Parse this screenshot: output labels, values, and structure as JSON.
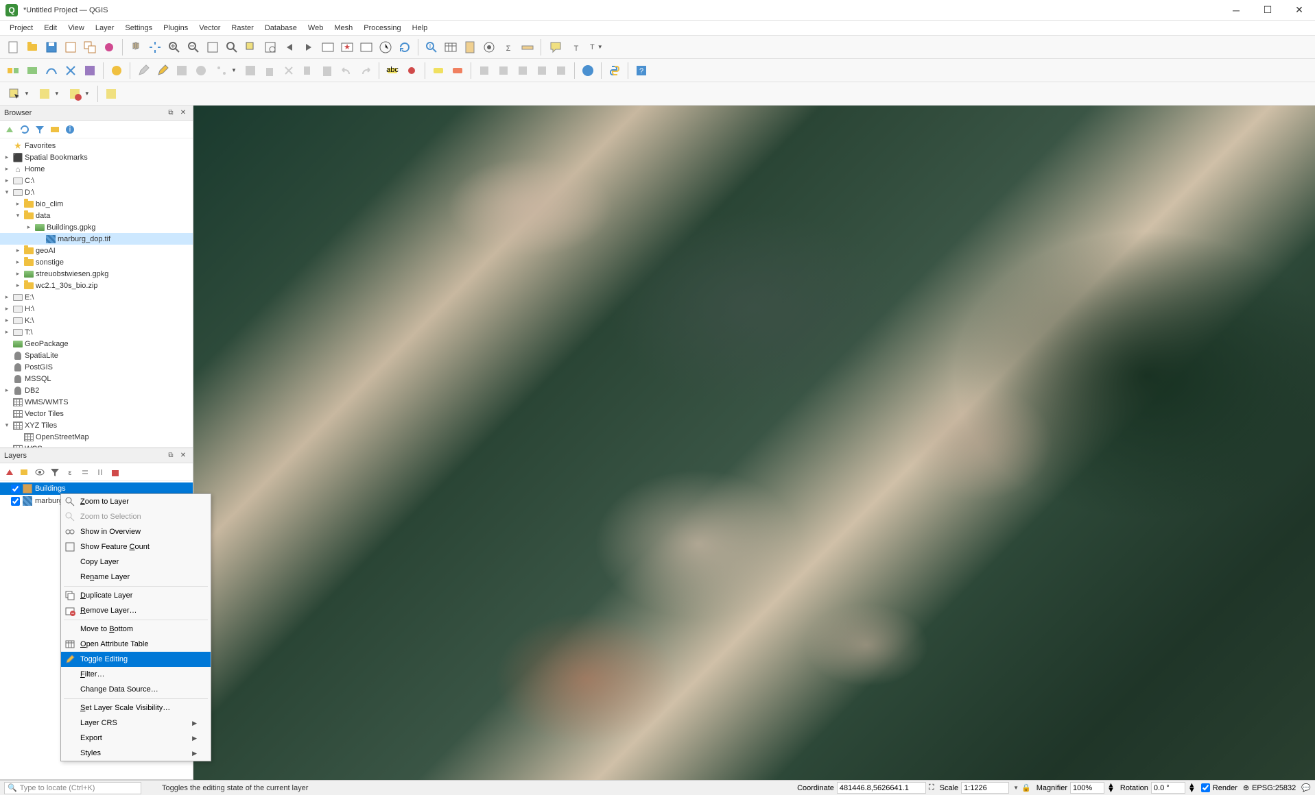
{
  "window": {
    "title": "*Untitled Project — QGIS"
  },
  "menubar": [
    "Project",
    "Edit",
    "View",
    "Layer",
    "Settings",
    "Plugins",
    "Vector",
    "Raster",
    "Database",
    "Web",
    "Mesh",
    "Processing",
    "Help"
  ],
  "browser": {
    "title": "Browser",
    "items": [
      {
        "label": "Favorites",
        "icon": "star",
        "indent": 0,
        "exp": ""
      },
      {
        "label": "Spatial Bookmarks",
        "icon": "bookmark",
        "indent": 0,
        "exp": "▸"
      },
      {
        "label": "Home",
        "icon": "home",
        "indent": 0,
        "exp": "▸"
      },
      {
        "label": "C:\\",
        "icon": "drive",
        "indent": 0,
        "exp": "▸"
      },
      {
        "label": "D:\\",
        "icon": "drive",
        "indent": 0,
        "exp": "▾"
      },
      {
        "label": "bio_clim",
        "icon": "folder",
        "indent": 1,
        "exp": "▸"
      },
      {
        "label": "data",
        "icon": "folder",
        "indent": 1,
        "exp": "▾"
      },
      {
        "label": "Buildings.gpkg",
        "icon": "geopackage",
        "indent": 2,
        "exp": "▸"
      },
      {
        "label": "marburg_dop.tif",
        "icon": "raster",
        "indent": 3,
        "exp": "",
        "selected": true
      },
      {
        "label": "geoAI",
        "icon": "folder",
        "indent": 1,
        "exp": "▸"
      },
      {
        "label": "sonstige",
        "icon": "folder",
        "indent": 1,
        "exp": "▸"
      },
      {
        "label": "streuobstwiesen.gpkg",
        "icon": "geopackage",
        "indent": 1,
        "exp": "▸"
      },
      {
        "label": "wc2.1_30s_bio.zip",
        "icon": "folder",
        "indent": 1,
        "exp": "▸"
      },
      {
        "label": "E:\\",
        "icon": "drive",
        "indent": 0,
        "exp": "▸"
      },
      {
        "label": "H:\\",
        "icon": "drive",
        "indent": 0,
        "exp": "▸"
      },
      {
        "label": "K:\\",
        "icon": "drive",
        "indent": 0,
        "exp": "▸"
      },
      {
        "label": "T:\\",
        "icon": "drive",
        "indent": 0,
        "exp": "▸"
      },
      {
        "label": "GeoPackage",
        "icon": "geopackage",
        "indent": 0,
        "exp": ""
      },
      {
        "label": "SpatiaLite",
        "icon": "db",
        "indent": 0,
        "exp": ""
      },
      {
        "label": "PostGIS",
        "icon": "db",
        "indent": 0,
        "exp": ""
      },
      {
        "label": "MSSQL",
        "icon": "db",
        "indent": 0,
        "exp": ""
      },
      {
        "label": "DB2",
        "icon": "db",
        "indent": 0,
        "exp": "▸"
      },
      {
        "label": "WMS/WMTS",
        "icon": "grid",
        "indent": 0,
        "exp": ""
      },
      {
        "label": "Vector Tiles",
        "icon": "grid",
        "indent": 0,
        "exp": ""
      },
      {
        "label": "XYZ Tiles",
        "icon": "grid",
        "indent": 0,
        "exp": "▾"
      },
      {
        "label": "OpenStreetMap",
        "icon": "grid",
        "indent": 1,
        "exp": ""
      },
      {
        "label": "WCS",
        "icon": "grid",
        "indent": 0,
        "exp": ""
      }
    ]
  },
  "layers": {
    "title": "Layers",
    "items": [
      {
        "label": "Buildings",
        "checked": true,
        "selected": true,
        "swatch": "#d4a050"
      },
      {
        "label": "marburg_dop",
        "checked": true,
        "selected": false,
        "swatch": "raster"
      }
    ]
  },
  "context_menu": {
    "items": [
      {
        "label": "Zoom to Layer",
        "icon": "zoom",
        "enabled": true,
        "u": 0
      },
      {
        "label": "Zoom to Selection",
        "icon": "zoom-sel",
        "enabled": false
      },
      {
        "label": "Show in Overview",
        "icon": "overview",
        "enabled": true
      },
      {
        "label": "Show Feature Count",
        "icon": "check",
        "enabled": true,
        "u": 13
      },
      {
        "label": "Copy Layer",
        "enabled": true
      },
      {
        "label": "Rename Layer",
        "enabled": true,
        "u": 2
      },
      {
        "sep": true
      },
      {
        "label": "Duplicate Layer",
        "icon": "dup",
        "enabled": true,
        "u": 0
      },
      {
        "label": "Remove Layer…",
        "icon": "remove",
        "enabled": true,
        "u": 0
      },
      {
        "sep": true
      },
      {
        "label": "Move to Bottom",
        "enabled": true,
        "u": 8
      },
      {
        "label": "Open Attribute Table",
        "icon": "table",
        "enabled": true,
        "u": 0
      },
      {
        "label": "Toggle Editing",
        "icon": "pencil",
        "enabled": true,
        "highlighted": true
      },
      {
        "label": "Filter…",
        "enabled": true,
        "u": 0
      },
      {
        "label": "Change Data Source…",
        "enabled": true
      },
      {
        "sep": true
      },
      {
        "label": "Set Layer Scale Visibility…",
        "enabled": true,
        "u": 0
      },
      {
        "label": "Layer CRS",
        "enabled": true,
        "submenu": true
      },
      {
        "label": "Export",
        "enabled": true,
        "submenu": true
      },
      {
        "label": "Styles",
        "enabled": true,
        "submenu": true
      }
    ]
  },
  "statusbar": {
    "locator_placeholder": "Type to locate (Ctrl+K)",
    "message": "Toggles the editing state of the current layer",
    "coordinate_label": "Coordinate",
    "coordinate_value": "481446.8,5626641.1",
    "scale_label": "Scale",
    "scale_value": "1:1226",
    "magnifier_label": "Magnifier",
    "magnifier_value": "100%",
    "rotation_label": "Rotation",
    "rotation_value": "0.0 °",
    "render_label": "Render",
    "crs": "EPSG:25832"
  }
}
